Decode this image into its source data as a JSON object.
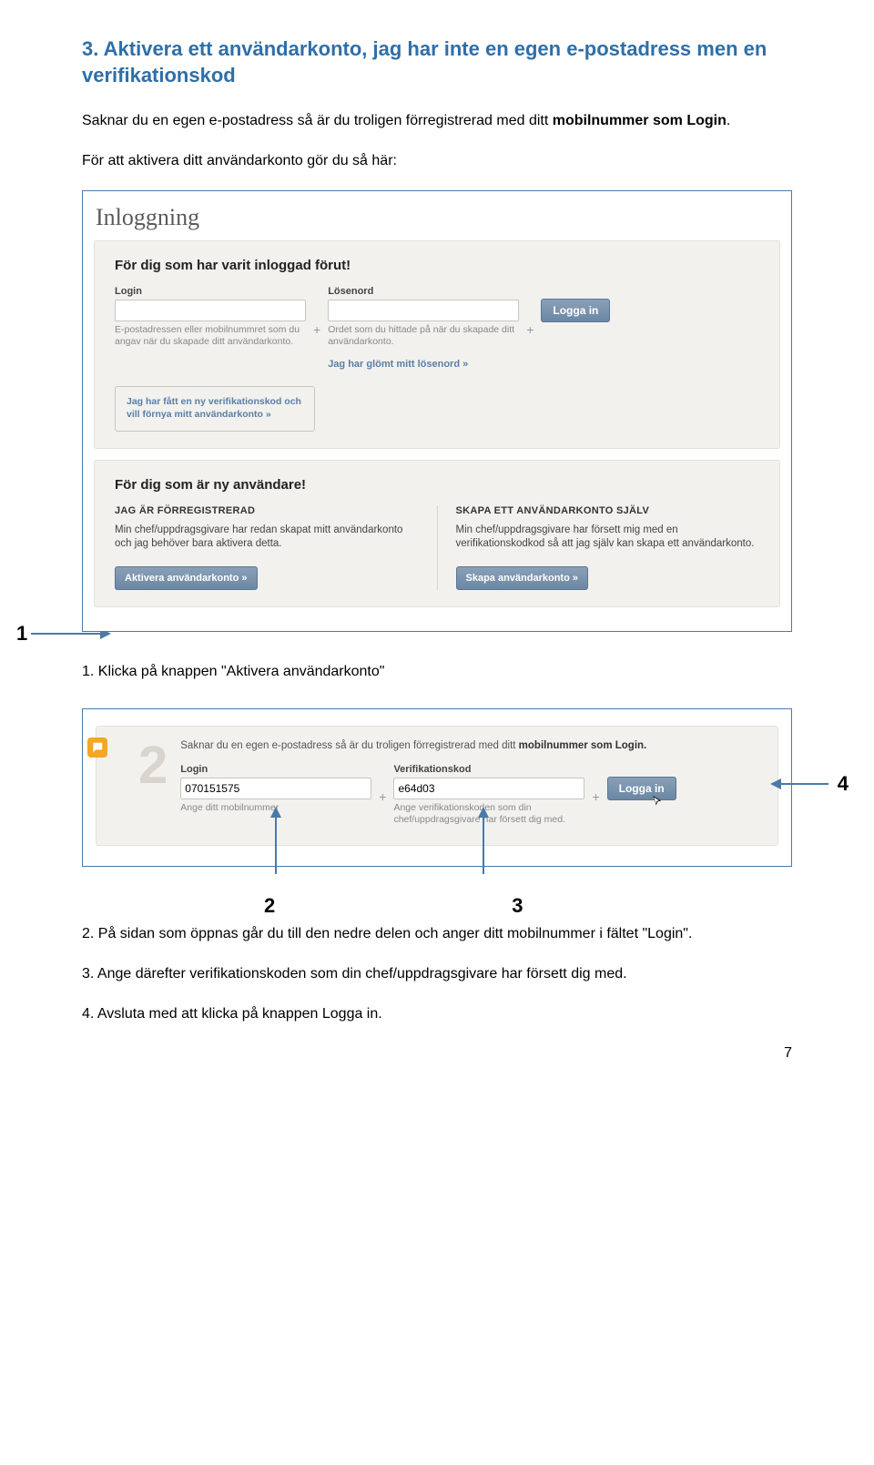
{
  "heading": "3. Aktivera ett användarkonto, jag har inte en egen e-postadress men en verifikationskod",
  "intro_line1": "Saknar du en egen e-postadress så är du troligen förregistrerad med ditt ",
  "intro_bold": "mobilnummer som Login",
  "intro_tail": ".",
  "intro_line2": "För att aktivera ditt användarkonto gör du så här:",
  "shot1": {
    "title": "Inloggning",
    "box1": {
      "heading": "För dig som har varit inloggad förut!",
      "login_label": "Login",
      "login_hint": "E-postadressen eller mobilnummret som du angav när du skapade ditt användarkonto.",
      "pass_label": "Lösenord",
      "pass_hint": "Ordet som du hittade på när du skapade ditt användarkonto.",
      "login_btn": "Logga in",
      "forgot": "Jag har glömt mitt lösenord »",
      "verif_box": "Jag har fått en ny verifikationskod och vill förnya mitt användarkonto »"
    },
    "box2": {
      "heading": "För dig som är ny användare!",
      "left_sub": "JAG ÄR FÖRREGISTRERAD",
      "left_desc": "Min chef/uppdragsgivare har redan skapat mitt användarkonto och jag behöver bara aktivera detta.",
      "left_btn": "Aktivera användarkonto »",
      "right_sub": "SKAPA ETT ANVÄNDARKONTO SJÄLV",
      "right_desc": "Min chef/uppdragsgivare har försett mig med en verifikationskodkod så att jag själv kan skapa ett användarkonto.",
      "right_btn": "Skapa användarkonto »"
    }
  },
  "step1": "1. Klicka på knappen \"Aktivera användarkonto\"",
  "shot2": {
    "intro": "Saknar du en egen e-postadress så är du troligen förregistrerad med ditt ",
    "intro_bold": "mobilnummer som Login.",
    "login_label": "Login",
    "login_value": "070151575",
    "login_hint": "Ange ditt mobilnummer",
    "code_label": "Verifikationskod",
    "code_value": "e64d03",
    "code_hint": "Ange verifikationskoden som din chef/uppdragsgivare har försett dig med.",
    "login_btn": "Logga in"
  },
  "step2": "2. På sidan som öppnas går du till den nedre delen och anger ditt mobilnummer i fältet \"Login\".",
  "step3": "3. Ange därefter verifikationskoden som din chef/uppdragsgivare har försett dig med.",
  "step4": "4. Avsluta med att klicka på knappen Logga in.",
  "callouts": {
    "c1": "1",
    "c2": "2",
    "c3": "3",
    "c4": "4"
  },
  "page_number": "7"
}
